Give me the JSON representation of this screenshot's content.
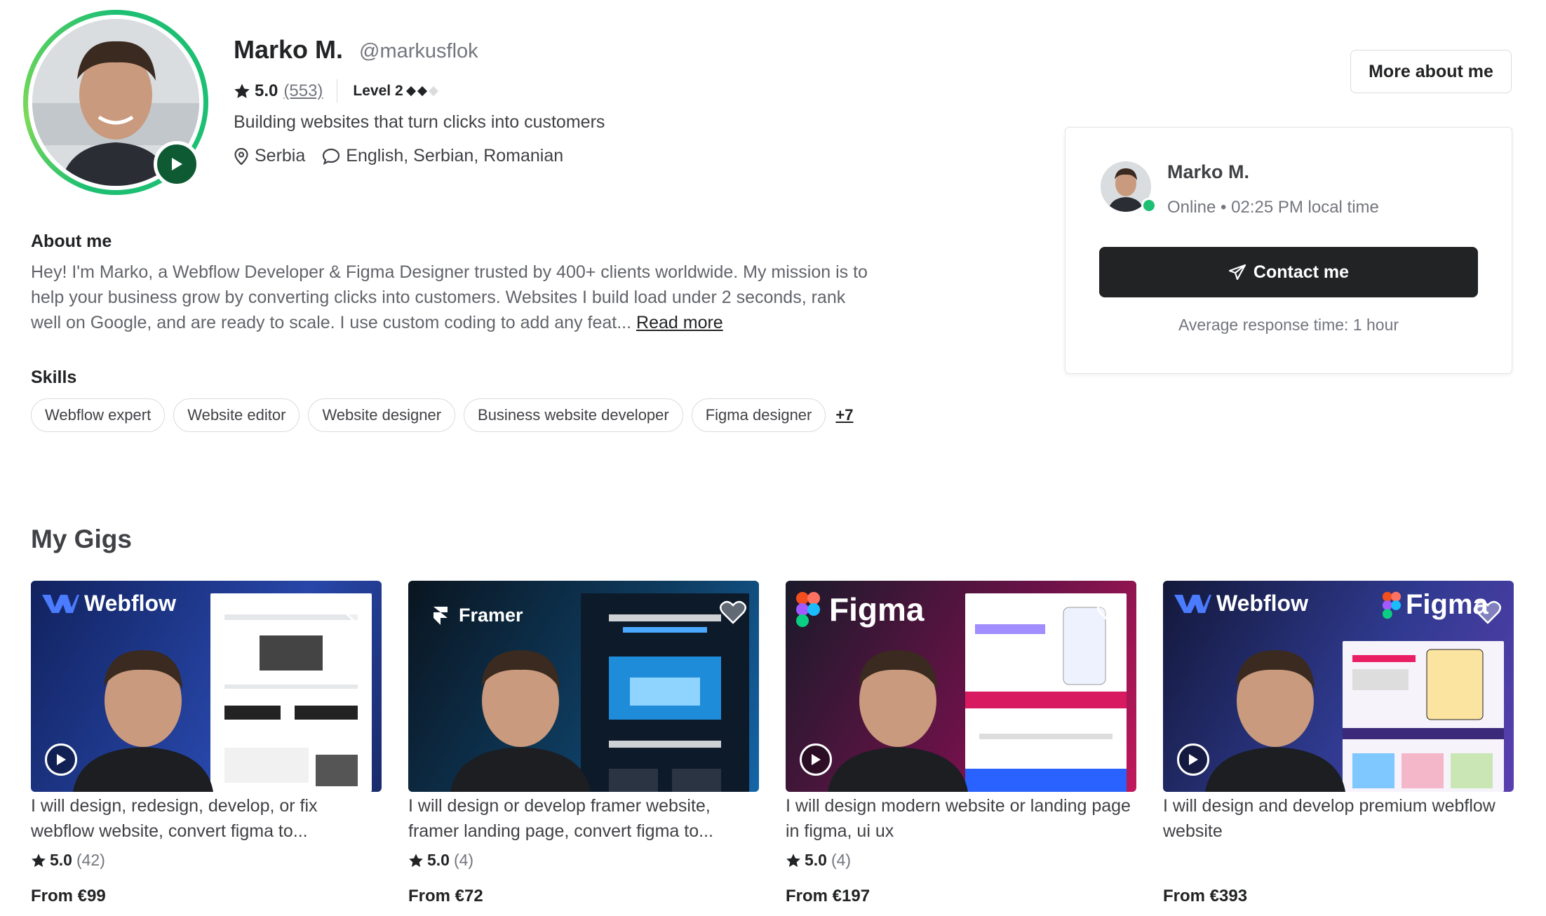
{
  "profile": {
    "name": "Marko M.",
    "username": "@markusflok",
    "rating": "5.0",
    "review_count": "(553)",
    "level": "Level 2",
    "tagline": "Building websites that turn clicks into customers",
    "location": "Serbia",
    "languages": "English, Serbian, Romanian"
  },
  "header": {
    "more_about_label": "More about me"
  },
  "about": {
    "heading": "About me",
    "text": "Hey! I'm Marko, a Webflow Developer & Figma Designer trusted by 400+ clients worldwide. My mission is to help your business grow by converting clicks into customers. Websites I build load under 2 seconds, rank well on Google, and are ready to scale. I use custom coding to add any feat...",
    "read_more": "Read more"
  },
  "skills": {
    "heading": "Skills",
    "items": [
      "Webflow expert",
      "Website editor",
      "Website designer",
      "Business website developer",
      "Figma designer"
    ],
    "more": "+7"
  },
  "contact_card": {
    "name": "Marko M.",
    "status": "Online • 02:25 PM local time",
    "button_label": "Contact me",
    "response_time": "Average response time: 1 hour"
  },
  "gigs": {
    "heading": "My Gigs",
    "items": [
      {
        "brand": "Webflow",
        "title": "I will design, redesign, develop, or fix webflow website, convert figma to...",
        "rating": "5.0",
        "count": "(42)",
        "price": "From €99",
        "bg": "#1a2b6b"
      },
      {
        "brand": "Framer",
        "title": "I will design or develop framer website, framer landing page, convert figma to...",
        "rating": "5.0",
        "count": "(4)",
        "price": "From €72",
        "bg": "#0b1b2c"
      },
      {
        "brand": "Figma",
        "title": "I will design modern website or landing page in figma, ui ux",
        "rating": "5.0",
        "count": "(4)",
        "price": "From €197",
        "bg": "#5a0f3a"
      },
      {
        "brand": "Webflow",
        "brand2": "Figma",
        "title": "I will design and develop premium webflow website",
        "rating": "",
        "count": "",
        "price": "From €393",
        "bg": "#2b2f66"
      }
    ]
  },
  "colors": {
    "accent": "#1dbf73",
    "dark": "#222325",
    "muted": "#74767e"
  }
}
